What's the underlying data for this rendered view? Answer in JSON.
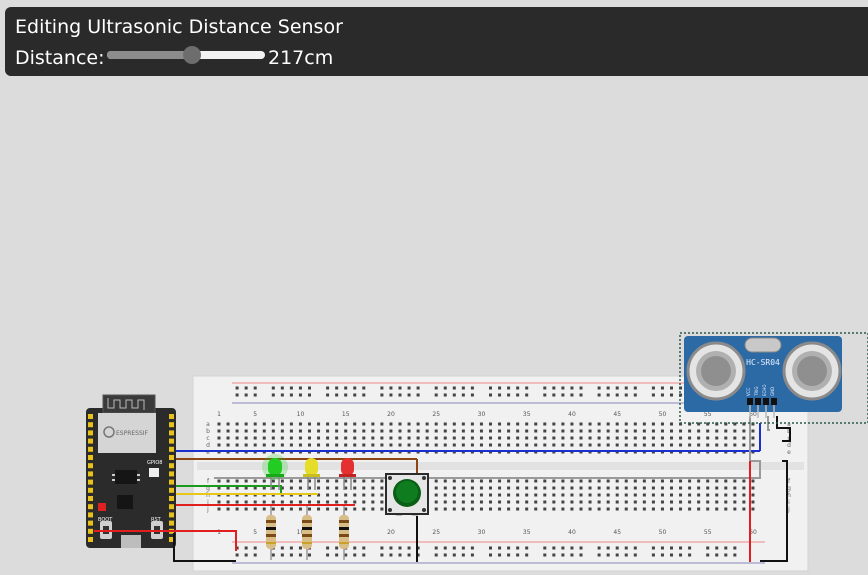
{
  "panel": {
    "title": "Editing Ultrasonic Distance Sensor",
    "distance_label": "Distance:",
    "distance_value": "217cm",
    "slider_fraction": 0.54
  },
  "board": {
    "logo_text": "ESPRESSIF",
    "gpio_text": "GPIO8",
    "boot_label": "BOOT",
    "rst_label": "RST"
  },
  "breadboard": {
    "column_numbers": [
      "1",
      "5",
      "10",
      "15",
      "20",
      "25",
      "30",
      "35",
      "40",
      "45",
      "50",
      "55",
      "60"
    ],
    "row_letters_top": [
      "a",
      "b",
      "c",
      "d",
      "e"
    ],
    "row_letters_bottom": [
      "f",
      "g",
      "h",
      "i",
      "j"
    ]
  },
  "sensor": {
    "model": "HC-SR04",
    "pins": [
      "VCC",
      "TRIG",
      "ECHO",
      "GND"
    ]
  },
  "colors": {
    "panel_bg": "#2a2a2a",
    "board": "#2b2b2b",
    "breadboard": "#f1f1f1",
    "sensor": "#2c6aa6",
    "wire_blue": "#1a2fd1",
    "wire_brown": "#8b4513",
    "wire_green": "#1c9a1c",
    "wire_yellow": "#e6c81a",
    "wire_red": "#e02020",
    "wire_black": "#111111",
    "wire_gray": "#9a9a9a",
    "led_green": "#22cc22",
    "led_yellow": "#e6dc2a",
    "led_red": "#e53030",
    "button_cap": "#0f7d1f"
  }
}
